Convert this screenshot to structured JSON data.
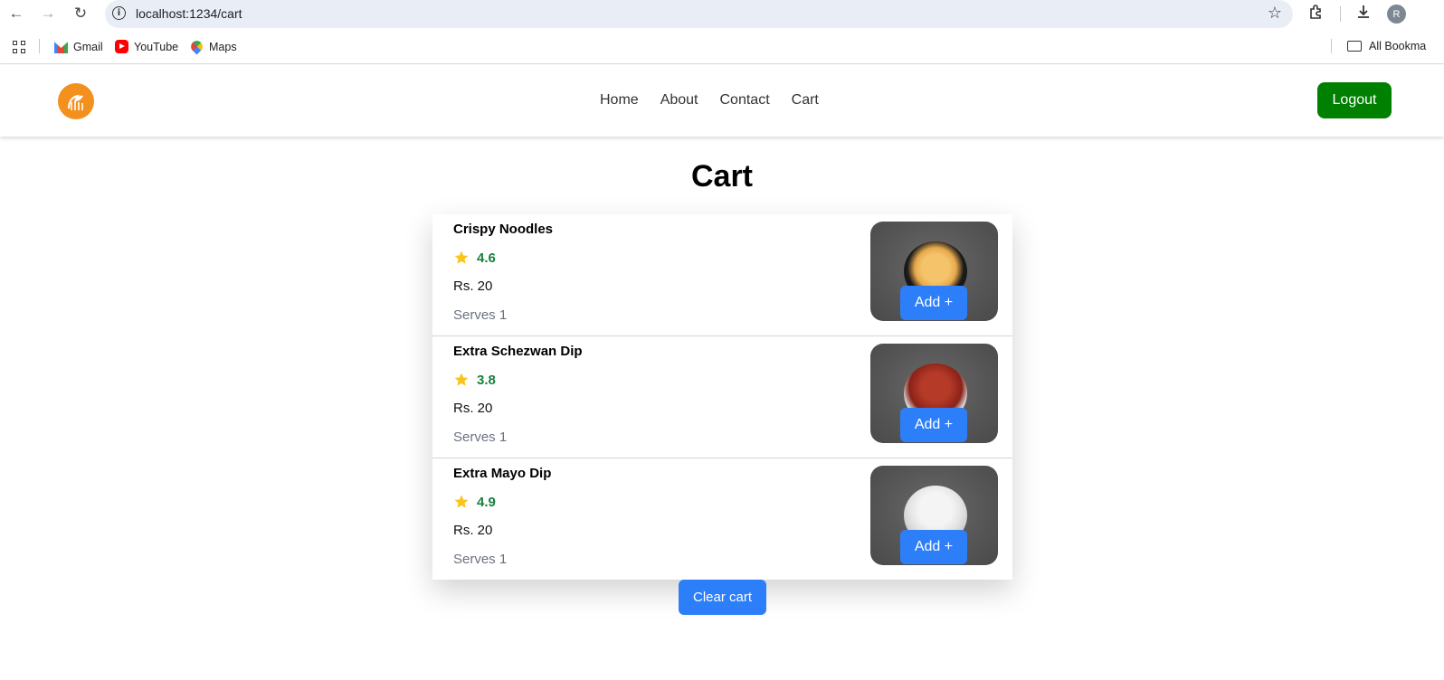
{
  "browser": {
    "url": "localhost:1234/cart",
    "profile_initial": "R",
    "bookmarks": [
      {
        "label": "Gmail",
        "icon": "gmail-icon"
      },
      {
        "label": "YouTube",
        "icon": "youtube-icon"
      },
      {
        "label": "Maps",
        "icon": "maps-icon"
      }
    ],
    "all_bookmarks_label": "All Bookma"
  },
  "header": {
    "nav": [
      "Home",
      "About",
      "Contact",
      "Cart"
    ],
    "logout_label": "Logout"
  },
  "page": {
    "title": "Cart",
    "items": [
      {
        "name": "Crispy Noodles",
        "rating": "4.6",
        "price": "Rs. 20",
        "serves": "Serves 1",
        "add_label": "Add +"
      },
      {
        "name": "Extra Schezwan Dip",
        "rating": "3.8",
        "price": "Rs. 20",
        "serves": "Serves 1",
        "add_label": "Add +"
      },
      {
        "name": "Extra Mayo Dip",
        "rating": "4.9",
        "price": "Rs. 20",
        "serves": "Serves 1",
        "add_label": "Add +"
      }
    ],
    "clear_label": "Clear cart"
  },
  "colors": {
    "logo": "#f4901e",
    "logout": "#008000",
    "primary_button": "#2d7ff9",
    "rating_text": "#16803c",
    "star": "#f8c51c"
  }
}
